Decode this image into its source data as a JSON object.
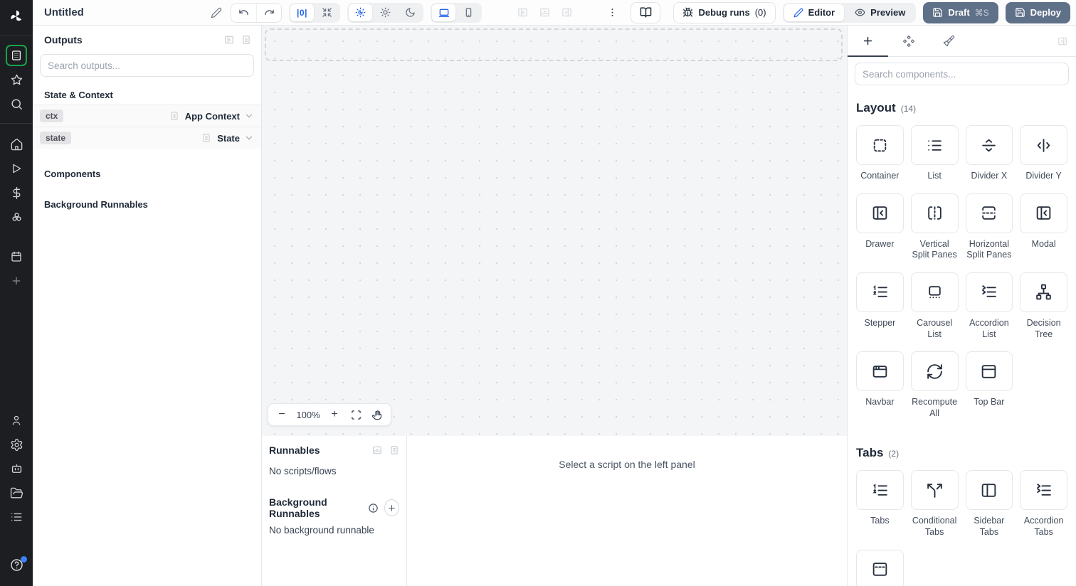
{
  "colors": {
    "accent_blue": "#2563eb",
    "brand_green": "#18a34a",
    "slate_button": "#5f7089",
    "rail_bg": "#1d1e22",
    "canvas_bg": "#f4f5f7"
  },
  "topbar": {
    "title": "Untitled",
    "align_button_glyph": "|0|",
    "debug_runs_label": "Debug runs",
    "debug_runs_count": "(0)",
    "editor_label": "Editor",
    "preview_label": "Preview",
    "draft_label": "Draft",
    "draft_shortcut": "⌘S",
    "deploy_label": "Deploy"
  },
  "outputs_panel": {
    "title": "Outputs",
    "search_placeholder": "Search outputs...",
    "sections": {
      "state_context": "State & Context",
      "components": "Components",
      "background_runnables": "Background Runnables"
    },
    "rows": [
      {
        "key": "ctx",
        "type": "App Context"
      },
      {
        "key": "state",
        "type": "State"
      }
    ]
  },
  "canvas": {
    "zoom_level": "100%"
  },
  "runnables_panel": {
    "title": "Runnables",
    "empty_scripts": "No scripts/flows",
    "background_title": "Background Runnables",
    "empty_background": "No background runnable"
  },
  "script_panel": {
    "placeholder": "Select a script on the left panel"
  },
  "components_panel": {
    "search_placeholder": "Search components...",
    "sections": [
      {
        "title": "Layout",
        "count": "(14)",
        "items": [
          "Container",
          "List",
          "Divider X",
          "Divider Y",
          "Drawer",
          "Vertical Split Panes",
          "Horizontal Split Panes",
          "Modal",
          "Stepper",
          "Carousel List",
          "Accordion List",
          "Decision Tree",
          "Navbar",
          "Recompute All",
          "Top Bar"
        ]
      },
      {
        "title": "Tabs",
        "count": "(2)",
        "items": [
          "Tabs",
          "Conditional Tabs",
          "Sidebar Tabs",
          "Accordion Tabs"
        ]
      }
    ]
  }
}
